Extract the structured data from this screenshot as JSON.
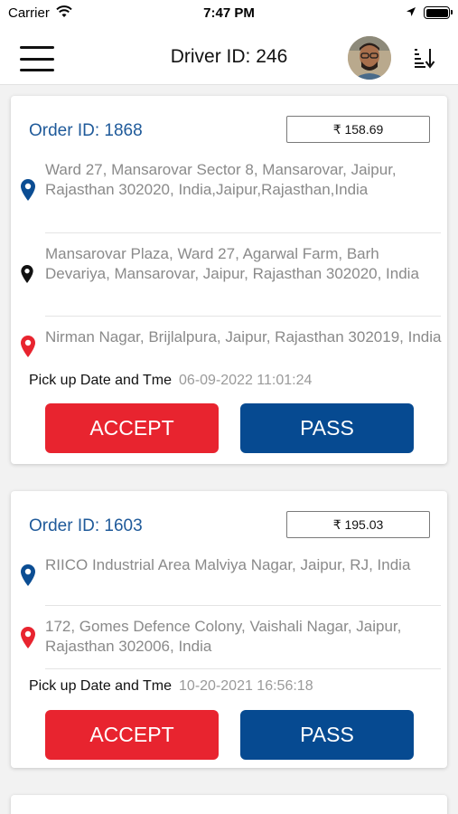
{
  "status_bar": {
    "carrier": "Carrier",
    "time": "7:47 PM"
  },
  "header": {
    "title": "Driver ID: 246"
  },
  "orders": [
    {
      "order_id": "Order ID: 1868",
      "price": "₹ 158.69",
      "pickup_address": "Ward 27, Mansarovar Sector 8, Mansarovar, Jaipur, Rajasthan 302020, India,Jaipur,Rajasthan,India",
      "stop_address": "Mansarovar Plaza, Ward 27, Agarwal Farm, Barh Devariya, Mansarovar, Jaipur, Rajasthan 302020, India",
      "drop_address": "Nirman Nagar, Brijlalpura, Jaipur, Rajasthan 302019, India",
      "pickup_label": "Pick up Date and Tme",
      "pickup_time": "06-09-2022 11:01:24",
      "accept_label": "ACCEPT",
      "pass_label": "PASS"
    },
    {
      "order_id": "Order ID: 1603",
      "price": "₹ 195.03",
      "pickup_address": "RIICO Industrial Area Malviya Nagar, Jaipur, RJ, India",
      "drop_address": "172, Gomes Defence Colony, Vaishali Nagar, Jaipur, Rajasthan 302006, India",
      "pickup_label": "Pick up Date and Tme",
      "pickup_time": "10-20-2021 16:56:18",
      "accept_label": "ACCEPT",
      "pass_label": "PASS"
    }
  ],
  "colors": {
    "accent_blue": "#1f5a9a",
    "accept_red": "#e8242f",
    "pass_blue": "#064a91",
    "pickup_pin": "#0b4d93",
    "stop_pin": "#111111",
    "drop_pin": "#e8242f"
  },
  "icons": {
    "menu": "hamburger-menu-icon",
    "sort": "sort-icon",
    "pickup_pin": "map-pin-blue-icon",
    "stop_pin": "map-pin-black-icon",
    "drop_pin": "map-pin-red-icon",
    "wifi": "wifi-icon",
    "location": "location-arrow-icon",
    "battery": "battery-icon"
  }
}
